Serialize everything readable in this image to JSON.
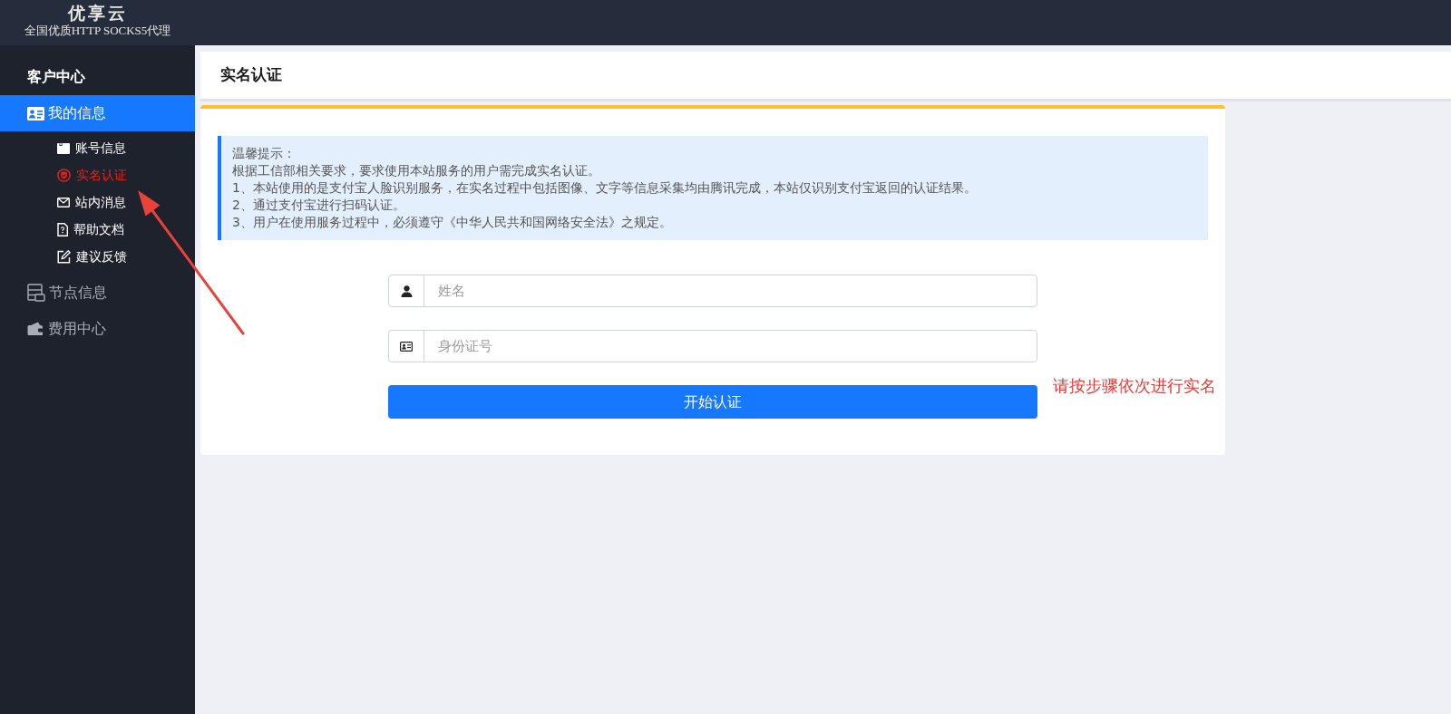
{
  "header": {
    "logo_title": "优享云",
    "logo_subtitle": "全国优质HTTP SOCKS5代理"
  },
  "sidebar": {
    "heading": "客户中心",
    "items": [
      {
        "label": "我的信息",
        "selected": true,
        "children": [
          {
            "label": "账号信息",
            "selected": false
          },
          {
            "label": "实名认证",
            "selected": true
          },
          {
            "label": "站内消息",
            "selected": false
          },
          {
            "label": "帮助文档",
            "selected": false
          },
          {
            "label": "建议反馈",
            "selected": false
          }
        ]
      },
      {
        "label": "节点信息",
        "selected": false
      },
      {
        "label": "费用中心",
        "selected": false
      }
    ]
  },
  "page_header": {
    "title": "实名认证"
  },
  "notice": {
    "title": "温馨提示：",
    "lines": [
      "根据工信部相关要求，要求使用本站服务的用户需完成实名认证。",
      "1、本站使用的是支付宝人脸识别服务，在实名过程中包括图像、文字等信息采集均由腾讯完成，本站仅识别支付宝返回的认证结果。",
      "2、通过支付宝进行扫码认证。",
      "3、用户在使用服务过程中，必须遵守《中华人民共和国网络安全法》之规定。"
    ]
  },
  "form": {
    "fields": [
      {
        "placeholder": "姓名"
      },
      {
        "placeholder": "身份证号"
      }
    ],
    "submit": "开始认证"
  },
  "annotation": {
    "text": "请按步骤依次进行实名"
  }
}
